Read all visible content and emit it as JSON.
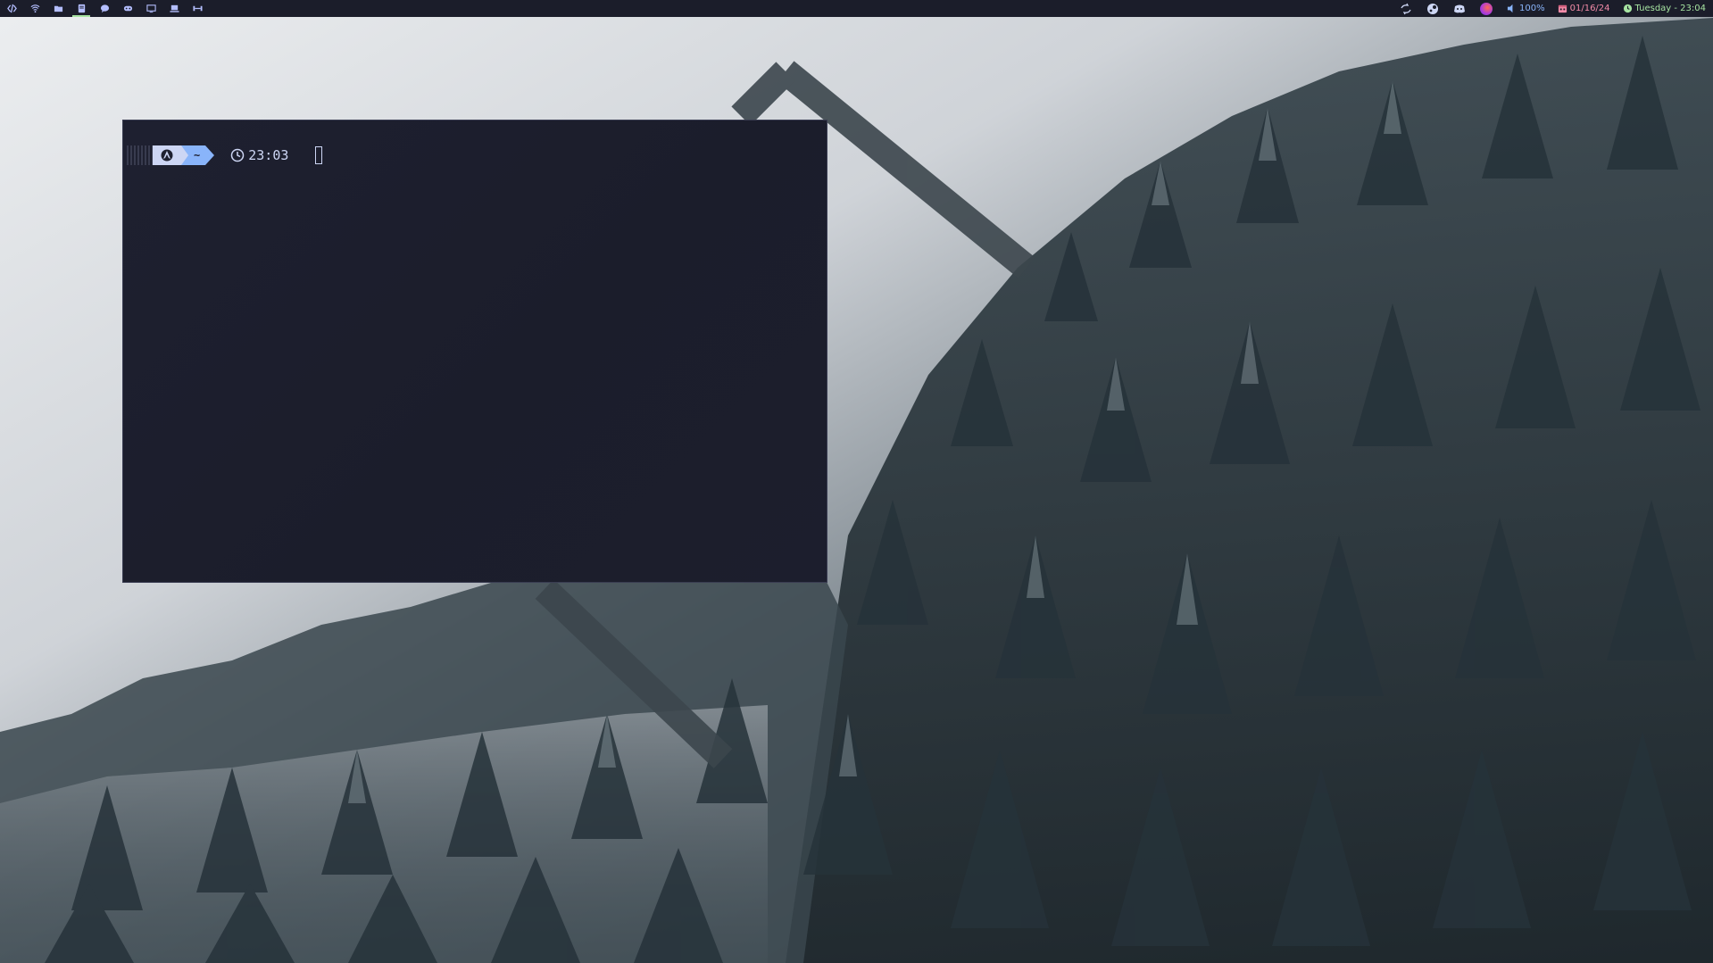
{
  "topbar": {
    "workspaces": [
      {
        "icon": "code-icon",
        "active": false
      },
      {
        "icon": "wifi-icon",
        "active": false
      },
      {
        "icon": "folder-icon",
        "active": false
      },
      {
        "icon": "book-icon",
        "active": true
      },
      {
        "icon": "chat-bubble-icon",
        "active": false
      },
      {
        "icon": "gamepad-icon",
        "active": false
      },
      {
        "icon": "monitor-icon",
        "active": false
      },
      {
        "icon": "laptop-icon",
        "active": false
      },
      {
        "icon": "dumbbell-icon",
        "active": false
      }
    ],
    "tray": [
      "sync-icon",
      "steam-icon",
      "discord-icon",
      "firefox-icon"
    ],
    "volume": "100%",
    "date": "01/16/24",
    "clock": "Tuesday - 23:04",
    "colors": {
      "bar_bg": "#1b1d2a",
      "workspace_icon": "#b4befe",
      "active_underline": "#a6e3a1",
      "volume": "#89b4fa",
      "date": "#f38ba8",
      "clock": "#a6e3a1"
    }
  },
  "terminal": {
    "os_icon": "arch-linux-icon",
    "directory": "~",
    "time": "23:03",
    "colors": {
      "background": "#1e2030",
      "os_segment": "#cdd6f4",
      "dir_segment": "#89b4fa",
      "foreground": "#cdd6f4"
    }
  }
}
